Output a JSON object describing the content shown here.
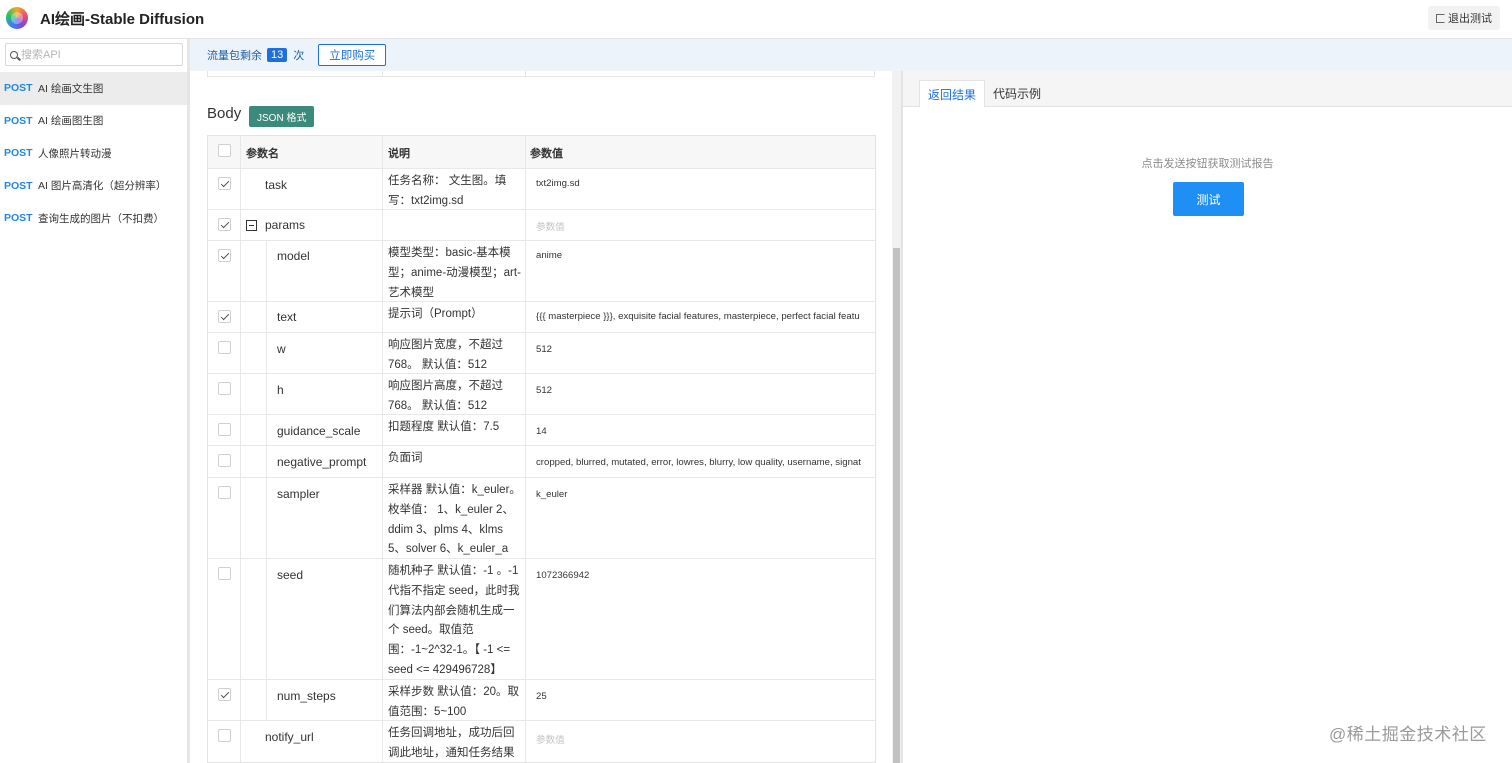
{
  "header": {
    "app_title": "AI绘画-Stable Diffusion",
    "logout_label": "退出测试"
  },
  "sidebar": {
    "search_placeholder": "搜索API",
    "items": [
      {
        "method": "POST",
        "label": "AI 绘画文生图",
        "active": true
      },
      {
        "method": "POST",
        "label": "AI 绘画图生图",
        "active": false
      },
      {
        "method": "POST",
        "label": "人像照片转动漫",
        "active": false
      },
      {
        "method": "POST",
        "label": "AI 图片高清化（超分辨率）",
        "active": false
      },
      {
        "method": "POST",
        "label": "查询生成的图片（不扣费）",
        "active": false
      }
    ]
  },
  "flowbar": {
    "prefix": "流量包剩余",
    "count": "13",
    "suffix": "次",
    "buy_label": "立即购买"
  },
  "body_section": {
    "title": "Body",
    "format_badge": "JSON 格式"
  },
  "params_table": {
    "headers": {
      "name": "参数名",
      "desc": "说明",
      "value": "参数值"
    },
    "rows": [
      {
        "name": "task",
        "desc": "任务名称： 文生图。填写：txt2img.sd",
        "value": "txt2img.sd",
        "checked": true
      },
      {
        "name": "params",
        "desc": "",
        "value": "参数值",
        "checked": true
      },
      {
        "name": "model",
        "desc": "模型类型：basic-基本模型；anime-动漫模型；art-艺术模型",
        "value": "anime",
        "checked": true
      },
      {
        "name": "text",
        "desc": "提示词（Prompt）",
        "value": "{{{ masterpiece }}}, exquisite facial features, masterpiece, perfect facial featu",
        "checked": true
      },
      {
        "name": "w",
        "desc": "响应图片宽度，不超过768。 默认值：512",
        "value": "512",
        "checked": false
      },
      {
        "name": "h",
        "desc": "响应图片高度，不超过768。 默认值：512",
        "value": "512",
        "checked": false
      },
      {
        "name": "guidance_scale",
        "desc": "扣题程度 默认值：7.5",
        "value": "14",
        "checked": false
      },
      {
        "name": "negative_prompt",
        "desc": "负面词",
        "value": "cropped, blurred, mutated, error, lowres, blurry, low quality, username, signat",
        "checked": false
      },
      {
        "name": "sampler",
        "desc": "采样器 默认值：k_euler。枚举值： 1、k_euler 2、ddim 3、plms 4、klms 5、solver 6、k_euler_a",
        "value": "k_euler",
        "checked": false
      },
      {
        "name": "seed",
        "desc": "随机种子 默认值：-1 。-1代指不指定 seed，此时我们算法内部会随机生成一个 seed。取值范围：-1~2^32-1。【 -1 <= seed <= 429496728】",
        "value": "1072366942",
        "checked": false
      },
      {
        "name": "num_steps",
        "desc": "采样步数 默认值：20。取值范围：5~100",
        "value": "25",
        "checked": true
      },
      {
        "name": "notify_url",
        "desc": "任务回调地址，成功后回调此地址，通知任务结果",
        "value": "参数值",
        "checked": false
      }
    ]
  },
  "right_panel": {
    "tabs": [
      "返回结果",
      "代码示例"
    ],
    "hint": "点击发送按钮获取测试报告",
    "test_label": "测试"
  },
  "watermark": "@稀土掘金技术社区",
  "colors": {
    "accent": "#1e6fd9",
    "badge": "#3c8a7c",
    "test_button": "#1e8ff5"
  }
}
